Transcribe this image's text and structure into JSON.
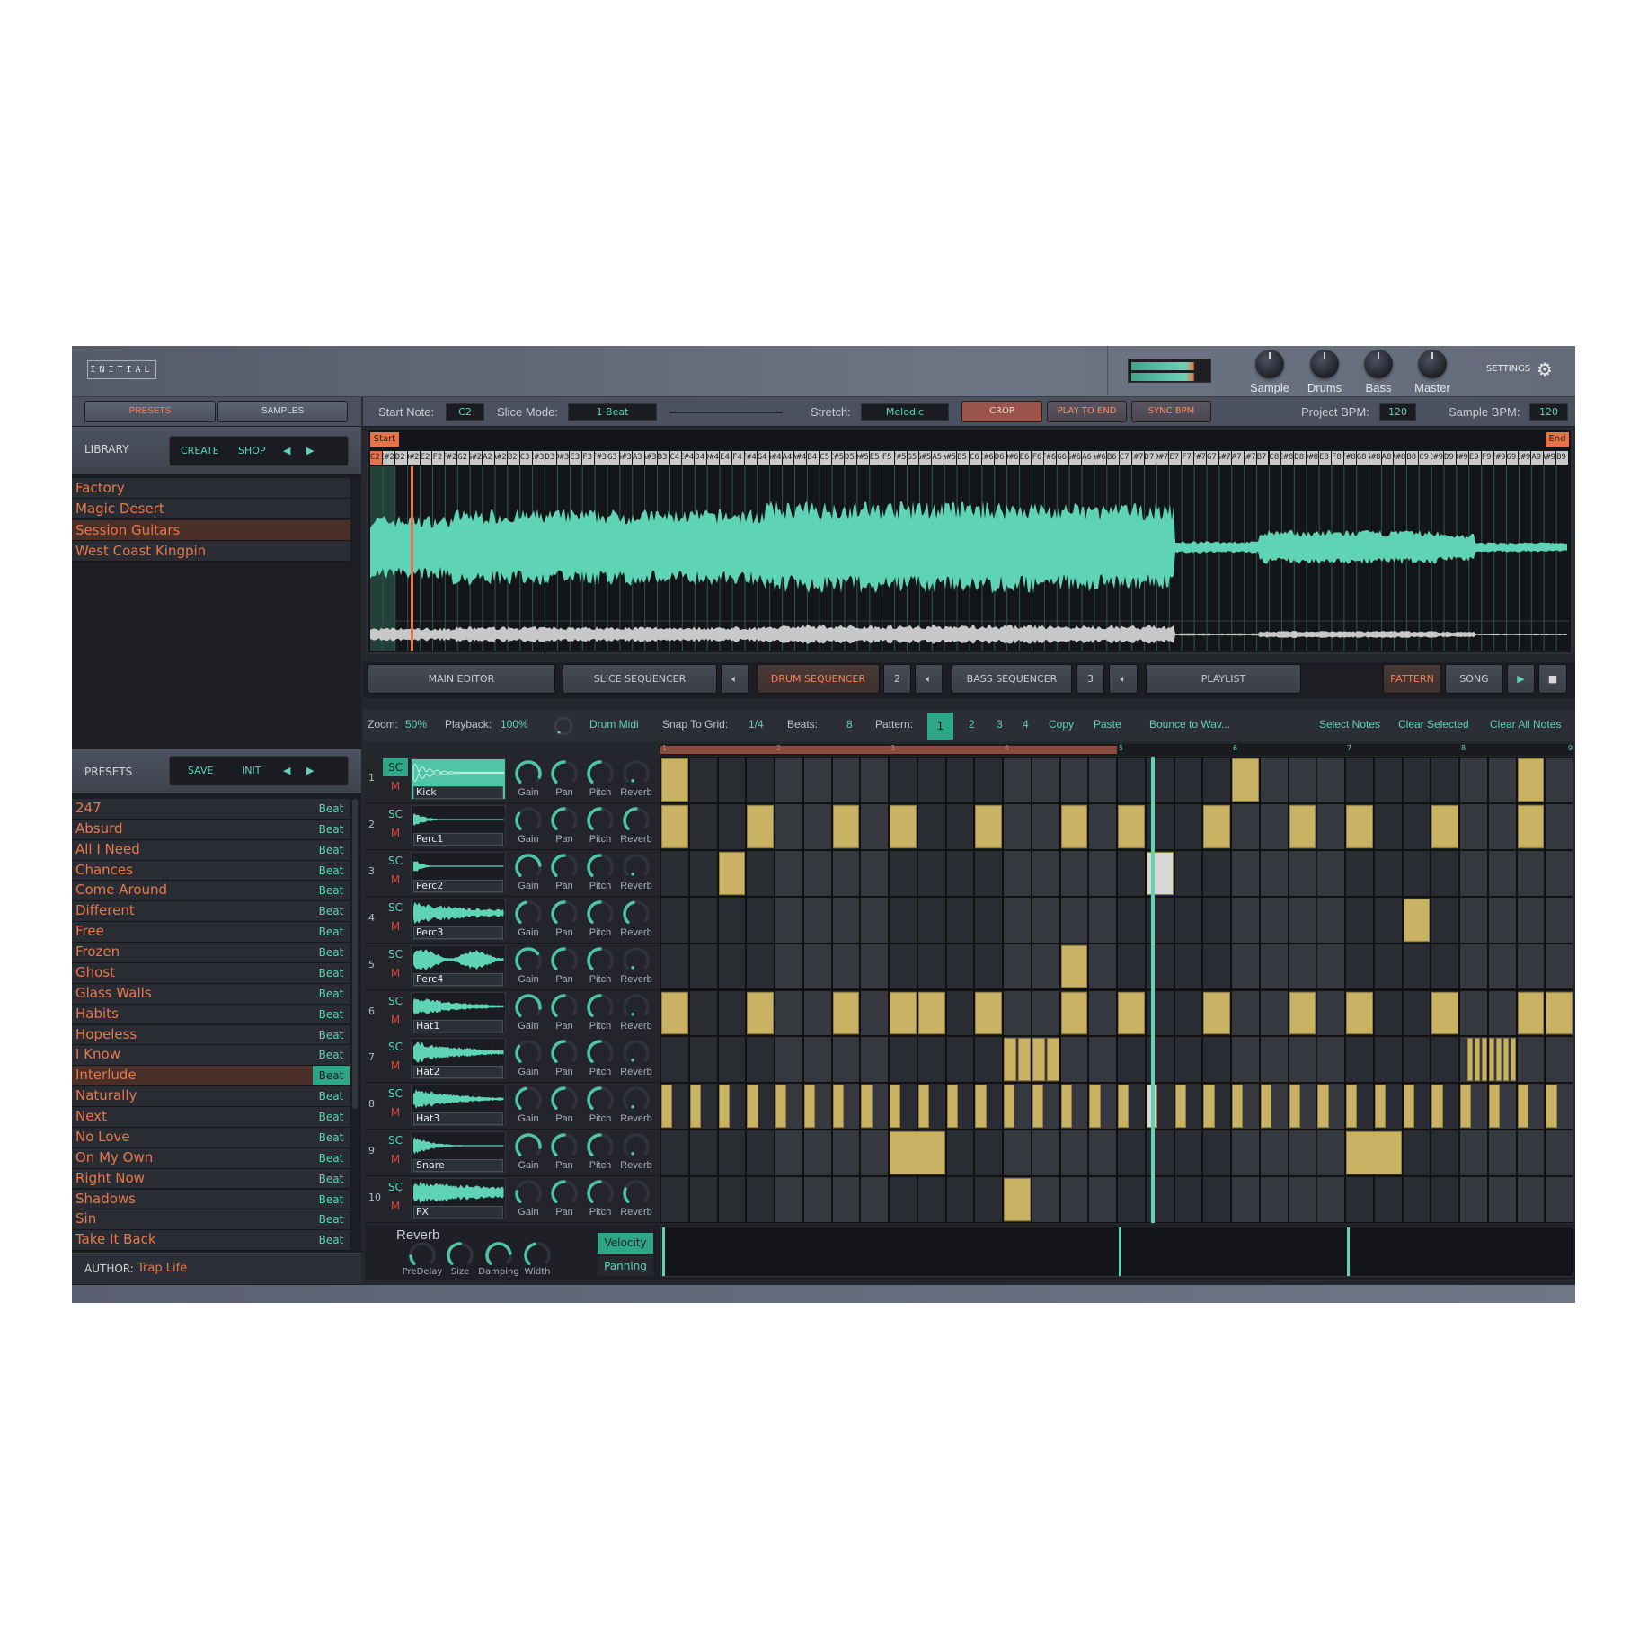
{
  "header": {
    "logo": "INITIAL",
    "knobs": [
      {
        "label": "Sample",
        "value": 0.5
      },
      {
        "label": "Drums",
        "value": 0.5
      },
      {
        "label": "Bass",
        "value": 0.5
      },
      {
        "label": "Master",
        "value": 0.5
      }
    ],
    "settings_label": "SETTINGS",
    "meter_level": 0.88
  },
  "left_tabs": [
    "PRESETS",
    "SAMPLES"
  ],
  "sample_bar": {
    "start_note_label": "Start Note:",
    "start_note": "C2",
    "slice_mode_label": "Slice Mode:",
    "slice_mode": "1 Beat",
    "stretch_label": "Stretch:",
    "stretch": "Melodic",
    "crop": "CROP",
    "play_to_end": "PLAY TO END",
    "sync_bpm": "SYNC BPM",
    "project_bpm_label": "Project BPM:",
    "project_bpm": "120",
    "sample_bpm_label": "Sample BPM:",
    "sample_bpm": "120"
  },
  "library": {
    "title": "LIBRARY",
    "buttons": [
      "CREATE",
      "SHOP"
    ],
    "items": [
      "Factory",
      "Magic Desert",
      "Session Guitars",
      "West Coast Kingpin"
    ],
    "selected": 2
  },
  "presets": {
    "title": "PRESETS",
    "buttons": [
      "SAVE",
      "INIT"
    ],
    "selected": 13,
    "items": [
      {
        "name": "247",
        "tag": "Beat"
      },
      {
        "name": "Absurd",
        "tag": "Beat"
      },
      {
        "name": "All I Need",
        "tag": "Beat"
      },
      {
        "name": "Chances",
        "tag": "Beat"
      },
      {
        "name": "Come Around",
        "tag": "Beat"
      },
      {
        "name": "Different",
        "tag": "Beat"
      },
      {
        "name": "Free",
        "tag": "Beat"
      },
      {
        "name": "Frozen",
        "tag": "Beat"
      },
      {
        "name": "Ghost",
        "tag": "Beat"
      },
      {
        "name": "Glass Walls",
        "tag": "Beat"
      },
      {
        "name": "Habits",
        "tag": "Beat"
      },
      {
        "name": "Hopeless",
        "tag": "Beat"
      },
      {
        "name": "I Know",
        "tag": "Beat"
      },
      {
        "name": "Interlude",
        "tag": "Beat"
      },
      {
        "name": "Naturally",
        "tag": "Beat"
      },
      {
        "name": "Next",
        "tag": "Beat"
      },
      {
        "name": "No Love",
        "tag": "Beat"
      },
      {
        "name": "On My Own",
        "tag": "Beat"
      },
      {
        "name": "Right Now",
        "tag": "Beat"
      },
      {
        "name": "Shadows",
        "tag": "Beat"
      },
      {
        "name": "Sin",
        "tag": "Beat"
      },
      {
        "name": "Take It Back",
        "tag": "Beat"
      }
    ],
    "author_label": "AUTHOR:",
    "author": "Trap Life"
  },
  "waveform": {
    "start_marker": "Start",
    "end_marker": "End",
    "slice_notes": [
      "C2",
      "C#2",
      "D2",
      "D#2",
      "E2",
      "F2",
      "F#2",
      "G2",
      "G#2",
      "A2",
      "A#2",
      "B2",
      "C3",
      "C#3",
      "D3",
      "D#3",
      "E3",
      "F3",
      "F#3",
      "G3",
      "G#3",
      "A3",
      "A#3",
      "B3",
      "C4",
      "C#4",
      "D4",
      "D#4",
      "E4",
      "F4",
      "F#4",
      "G4",
      "G#4",
      "A4",
      "A#4",
      "B4",
      "C5",
      "C#5",
      "D5",
      "D#5",
      "E5",
      "F5",
      "F#5",
      "G5",
      "G#5",
      "A5",
      "A#5",
      "B5",
      "C6",
      "C#6",
      "D6",
      "D#6",
      "E6",
      "F6",
      "F#6",
      "G6",
      "G#6",
      "A6",
      "A#6",
      "B6",
      "C7",
      "C#7",
      "D7",
      "D#7",
      "E7",
      "F7",
      "F#7",
      "G7",
      "G#7",
      "A7",
      "A#7",
      "B7",
      "C8",
      "C#8",
      "D8",
      "D#8",
      "E8",
      "F8",
      "F#8",
      "G8",
      "G#8",
      "A8",
      "A#8",
      "B8",
      "C9",
      "C#9",
      "D9",
      "D#9",
      "E9",
      "F9",
      "F#9",
      "G9",
      "G#9",
      "A9",
      "A#9",
      "B9"
    ],
    "colors": {
      "wave": "#5fd3b5",
      "overview": "#c8c8c8",
      "marker": "#e8734a"
    }
  },
  "editor_tabs": {
    "main_editor": "MAIN EDITOR",
    "slice_sequencer": "SLICE SEQUENCER",
    "drum_sequencer": "DRUM SEQUENCER",
    "drum_channel": "2",
    "bass_sequencer": "BASS SEQUENCER",
    "bass_channel": "3",
    "playlist": "PLAYLIST",
    "pattern": "PATTERN",
    "song": "SONG"
  },
  "toolbar": {
    "zoom_label": "Zoom:",
    "zoom": "50%",
    "playback_label": "Playback:",
    "playback": "100%",
    "drum_midi": "Drum Midi",
    "snap_label": "Snap To Grid:",
    "snap": "1/4",
    "beats_label": "Beats:",
    "beats": "8",
    "pattern_label": "Pattern:",
    "patterns": [
      "1",
      "2",
      "3",
      "4"
    ],
    "active_pattern": 0,
    "copy": "Copy",
    "paste": "Paste",
    "bounce": "Bounce to Wav...",
    "select_notes": "Select Notes",
    "clear_selected": "Clear Selected",
    "clear_all": "Clear All Notes"
  },
  "ruler": [
    "1",
    "2",
    "3",
    "4",
    "5",
    "6",
    "7",
    "8",
    "9"
  ],
  "loop_range_beats": [
    1,
    5
  ],
  "playhead_step": 17.2,
  "tracks": [
    {
      "num": "1",
      "name": "Kick",
      "sc": "SC",
      "m": "M",
      "sc_active": true,
      "knobs": {
        "Gain": 0.9,
        "Pan": 0.5,
        "Pitch": 0.5,
        "Reverb": 0
      }
    },
    {
      "num": "2",
      "name": "Perc1",
      "sc": "SC",
      "m": "M",
      "knobs": {
        "Gain": 0.3,
        "Pan": 0.5,
        "Pitch": 0.5,
        "Reverb": 0.5
      }
    },
    {
      "num": "3",
      "name": "Perc2",
      "sc": "SC",
      "m": "M",
      "knobs": {
        "Gain": 0.8,
        "Pan": 0.5,
        "Pitch": 0.5,
        "Reverb": 0
      }
    },
    {
      "num": "4",
      "name": "Perc3",
      "sc": "SC",
      "m": "M",
      "knobs": {
        "Gain": 0.45,
        "Pan": 0.5,
        "Pitch": 0.5,
        "Reverb": 0.45
      }
    },
    {
      "num": "5",
      "name": "Perc4",
      "sc": "SC",
      "m": "M",
      "knobs": {
        "Gain": 0.7,
        "Pan": 0.5,
        "Pitch": 0.5,
        "Reverb": 0
      }
    },
    {
      "num": "6",
      "name": "Hat1",
      "sc": "SC",
      "m": "M",
      "knobs": {
        "Gain": 0.85,
        "Pan": 0.5,
        "Pitch": 0.5,
        "Reverb": 0
      }
    },
    {
      "num": "7",
      "name": "Hat2",
      "sc": "SC",
      "m": "M",
      "knobs": {
        "Gain": 0.3,
        "Pan": 0.5,
        "Pitch": 0.5,
        "Reverb": 0
      }
    },
    {
      "num": "8",
      "name": "Hat3",
      "sc": "SC",
      "m": "M",
      "knobs": {
        "Gain": 0.45,
        "Pan": 0.5,
        "Pitch": 0.5,
        "Reverb": 0
      }
    },
    {
      "num": "9",
      "name": "Snare",
      "sc": "SC",
      "m": "M",
      "knobs": {
        "Gain": 0.85,
        "Pan": 0.5,
        "Pitch": 0.5,
        "Reverb": 0
      }
    },
    {
      "num": "10",
      "name": "FX",
      "sc": "SC",
      "m": "M",
      "knobs": {
        "Gain": 0.2,
        "Pan": 0.5,
        "Pitch": 0.5,
        "Reverb": 0.25
      }
    }
  ],
  "knob_labels": [
    "Gain",
    "Pan",
    "Pitch",
    "Reverb"
  ],
  "pattern_notes": [
    [
      [
        0,
        1
      ],
      [
        20,
        1
      ],
      [
        30,
        1
      ]
    ],
    [
      [
        0,
        1
      ],
      [
        3,
        1
      ],
      [
        6,
        1
      ],
      [
        8,
        1
      ],
      [
        11,
        1
      ],
      [
        14,
        1
      ],
      [
        16,
        1
      ],
      [
        19,
        1
      ],
      [
        22,
        1
      ],
      [
        24,
        1
      ],
      [
        27,
        1
      ],
      [
        30,
        1
      ]
    ],
    [
      [
        2,
        1
      ],
      [
        17,
        1,
        "selected"
      ]
    ],
    [
      [
        26,
        1
      ]
    ],
    [
      [
        14,
        1
      ]
    ],
    [
      [
        0,
        1
      ],
      [
        3,
        1
      ],
      [
        6,
        1
      ],
      [
        8,
        1
      ],
      [
        9,
        1
      ],
      [
        11,
        1
      ],
      [
        14,
        1
      ],
      [
        16,
        1
      ],
      [
        19,
        1
      ],
      [
        22,
        1
      ],
      [
        24,
        1
      ],
      [
        27,
        1
      ],
      [
        30,
        1
      ],
      [
        31,
        1
      ]
    ],
    [
      [
        12,
        0.5
      ],
      [
        12.5,
        0.5
      ],
      [
        13,
        0.5
      ],
      [
        13.5,
        0.5
      ],
      [
        28.25,
        0.25
      ],
      [
        28.5,
        0.25
      ],
      [
        28.75,
        0.25
      ],
      [
        29,
        0.25
      ],
      [
        29.25,
        0.25
      ],
      [
        29.5,
        0.25
      ],
      [
        29.75,
        0.25
      ]
    ],
    [
      [
        0,
        0.45
      ],
      [
        1,
        0.45
      ],
      [
        2,
        0.45
      ],
      [
        3,
        0.45
      ],
      [
        4,
        0.45
      ],
      [
        5,
        0.45
      ],
      [
        6,
        0.45
      ],
      [
        7,
        0.45
      ],
      [
        8,
        0.45
      ],
      [
        9,
        0.45
      ],
      [
        10,
        0.45
      ],
      [
        11,
        0.45
      ],
      [
        12,
        0.45
      ],
      [
        13,
        0.45
      ],
      [
        14,
        0.45
      ],
      [
        15,
        0.45
      ],
      [
        16,
        0.45
      ],
      [
        17,
        0.45,
        "selected"
      ],
      [
        18,
        0.45
      ],
      [
        19,
        0.45
      ],
      [
        20,
        0.45
      ],
      [
        21,
        0.45
      ],
      [
        22,
        0.45
      ],
      [
        23,
        0.45
      ],
      [
        24,
        0.45
      ],
      [
        25,
        0.45
      ],
      [
        26,
        0.45
      ],
      [
        27,
        0.45
      ],
      [
        28,
        0.45
      ],
      [
        29,
        0.45
      ],
      [
        30,
        0.45
      ],
      [
        31,
        0.45
      ]
    ],
    [
      [
        8,
        2
      ],
      [
        24,
        2
      ]
    ],
    [
      [
        12,
        1
      ]
    ]
  ],
  "steps": 32,
  "reverb": {
    "title": "Reverb",
    "knobs": [
      {
        "label": "PreDelay",
        "value": 0.15
      },
      {
        "label": "Size",
        "value": 0.5
      },
      {
        "label": "Damping",
        "value": 0.8
      },
      {
        "label": "Width",
        "value": 0.45
      }
    ]
  },
  "lanes": {
    "velocity": "Velocity",
    "panning": "Panning",
    "active": "velocity"
  },
  "colors": {
    "accent": "#5fd3b5",
    "orange": "#e8734a",
    "note": "#c9b263",
    "note_selected": "#d8d8d8"
  }
}
